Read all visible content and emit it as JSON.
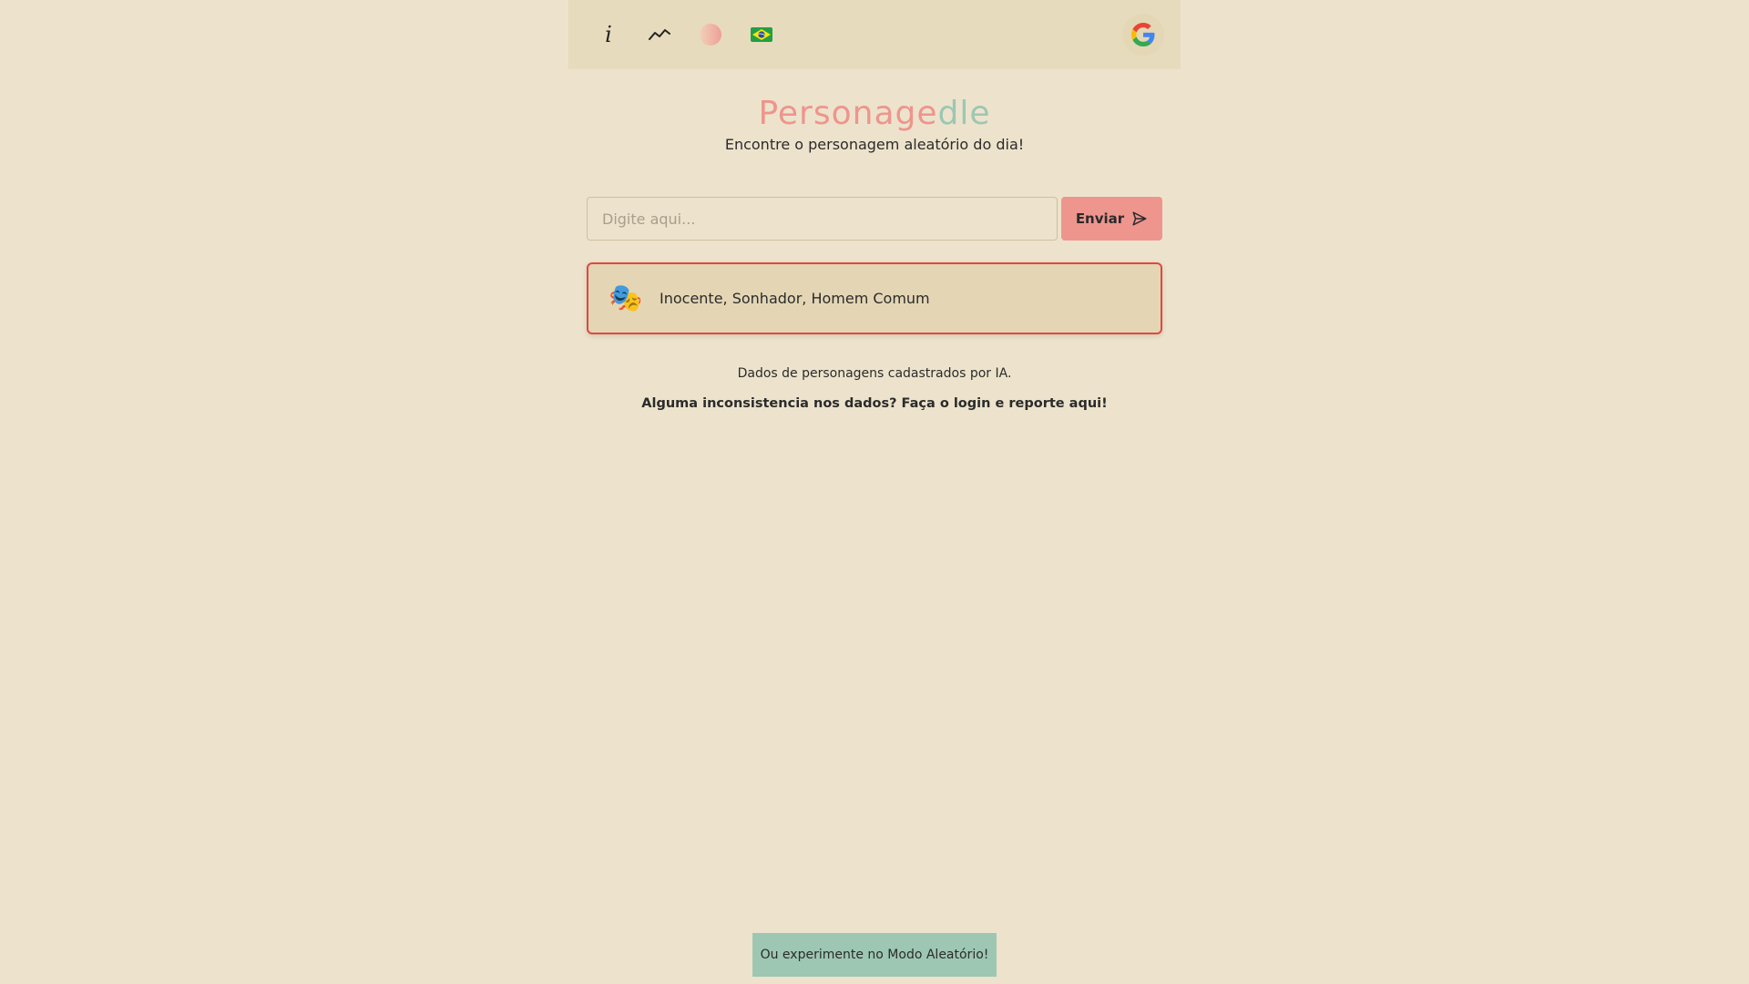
{
  "header": {
    "info_icon_glyph": "i",
    "icons": [
      "info-icon",
      "stats-chart-icon",
      "theme-toggle-icon",
      "brazil-flag-icon",
      "google-login-icon"
    ]
  },
  "title": {
    "part1": "Personage",
    "part2": "dle"
  },
  "subtitle": "Encontre o personagem aleatório do dia!",
  "search": {
    "placeholder": "Digite aqui...",
    "value": ""
  },
  "send_button": {
    "label": "Enviar"
  },
  "hint": {
    "emoji": "🎭",
    "text": "Inocente, Sonhador, Homem Comum"
  },
  "footer": {
    "credit": "Dados de personagens cadastrados por IA.",
    "report": "Alguma inconsistencia nos dados? Faça o login e reporte aqui!"
  },
  "random_mode_button": {
    "label": "Ou experimente no Modo Aleatório!"
  },
  "colors": {
    "background": "#ede3cc",
    "topbar": "#e7dbbd",
    "accent_pink": "#ee958e",
    "accent_green": "#9dc7b2",
    "hint_border": "#e0493f"
  }
}
